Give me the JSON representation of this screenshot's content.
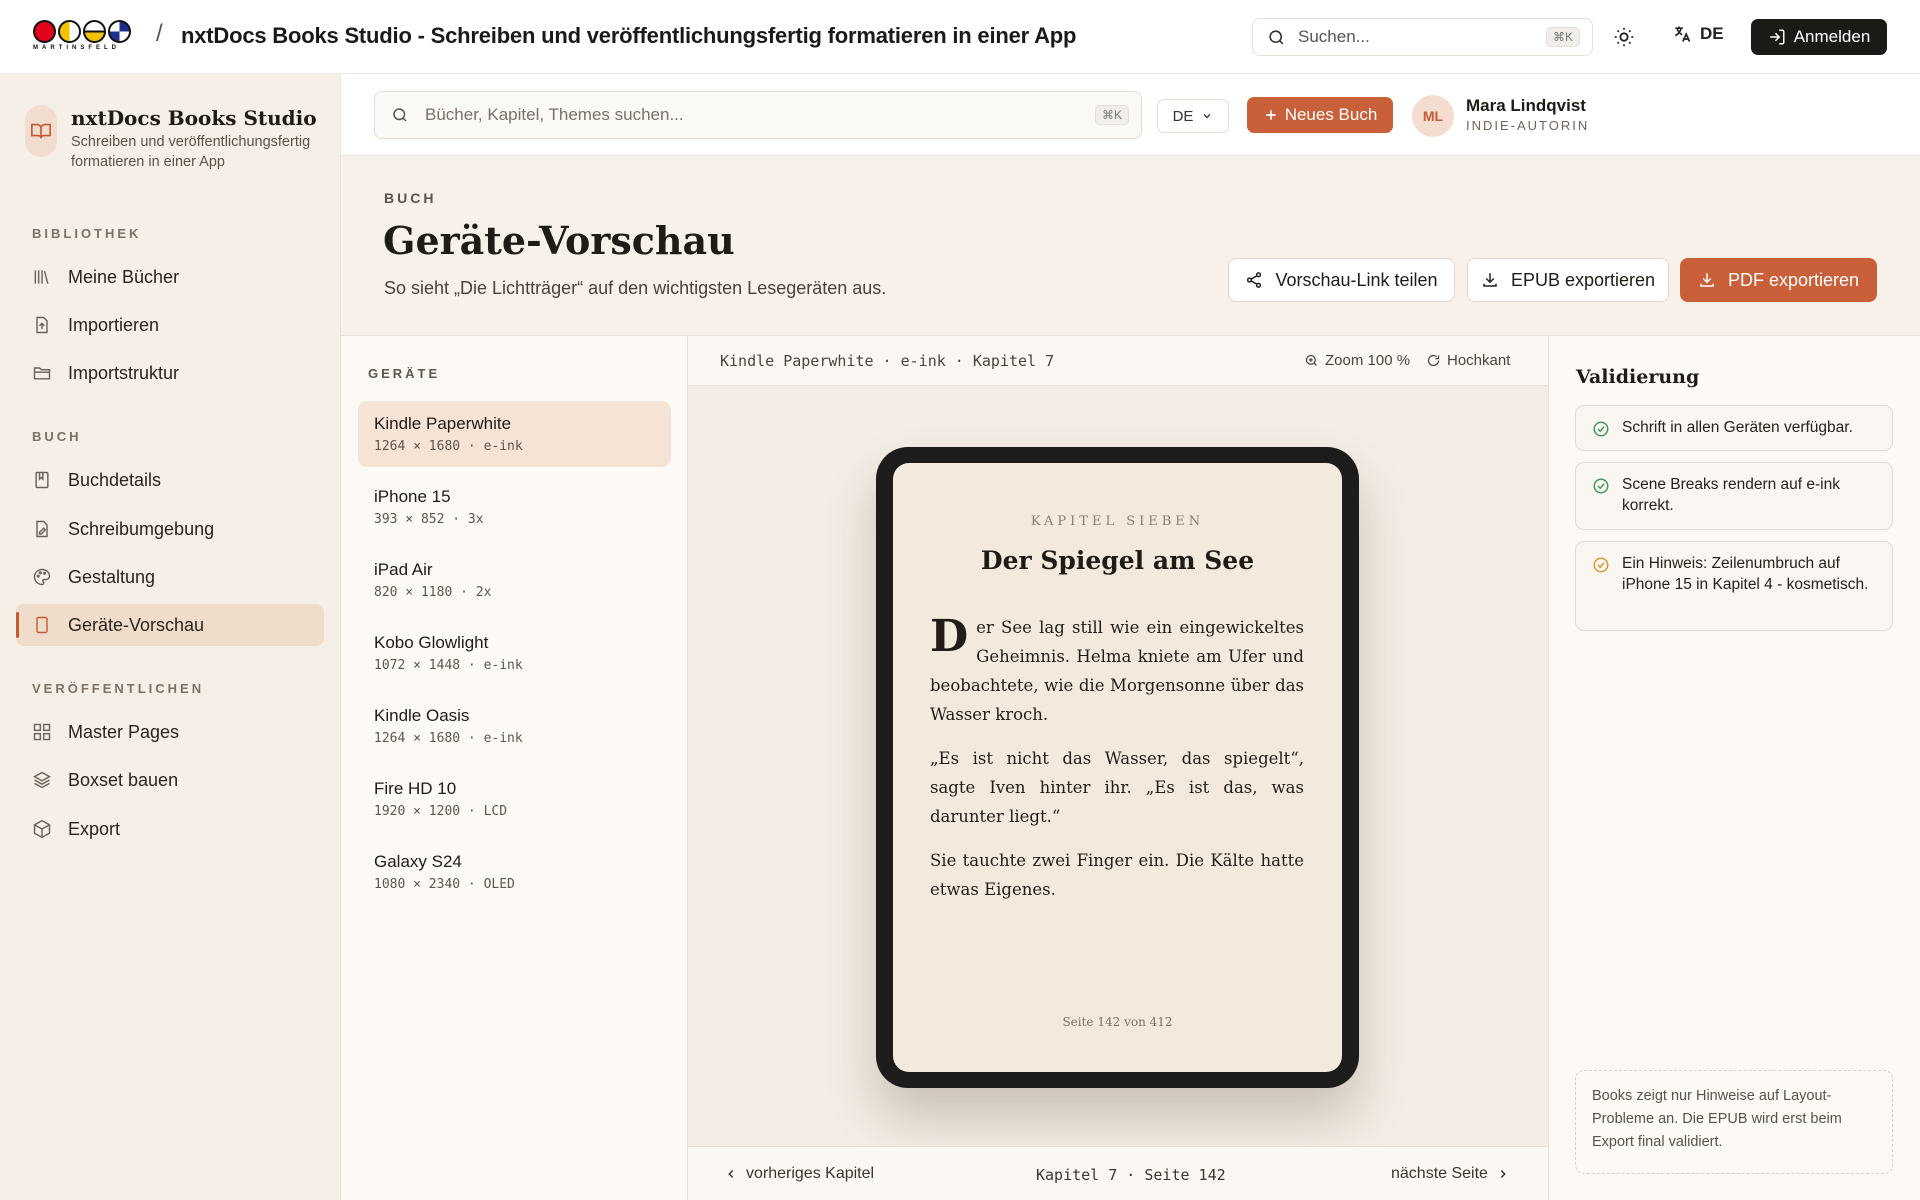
{
  "topbar": {
    "logo_text": "MARTINSFELD",
    "separator": "/",
    "title": "nxtDocs Books Studio - Schreiben und veröffentlichungsfertig formatieren in einer App",
    "search_placeholder": "Suchen...",
    "search_shortcut": "⌘K",
    "language": "DE",
    "login_label": "Anmelden"
  },
  "sidebar": {
    "brand_name": "nxtDocs Books Studio",
    "brand_sub": "Schreiben und veröffentlichungsfertig formatieren in einer App",
    "sections": [
      {
        "label": "BIBLIOTHEK",
        "items": [
          {
            "label": "Meine Bücher",
            "icon": "library-icon"
          },
          {
            "label": "Importieren",
            "icon": "import-icon"
          },
          {
            "label": "Importstruktur",
            "icon": "folder-icon"
          }
        ]
      },
      {
        "label": "BUCH",
        "items": [
          {
            "label": "Buchdetails",
            "icon": "book-icon"
          },
          {
            "label": "Schreibumgebung",
            "icon": "edit-document-icon"
          },
          {
            "label": "Gestaltung",
            "icon": "palette-icon"
          },
          {
            "label": "Geräte-Vorschau",
            "icon": "tablet-icon",
            "active": true
          }
        ]
      },
      {
        "label": "VERÖFFENTLICHEN",
        "items": [
          {
            "label": "Master Pages",
            "icon": "grid-icon"
          },
          {
            "label": "Boxset bauen",
            "icon": "layers-icon"
          },
          {
            "label": "Export",
            "icon": "package-icon"
          }
        ]
      }
    ]
  },
  "header": {
    "search_placeholder": "Bücher, Kapitel, Themes suchen...",
    "search_shortcut": "⌘K",
    "language_select": "DE",
    "new_book_label": "Neues Buch",
    "user_initials": "ML",
    "user_name": "Mara Lindqvist",
    "user_role": "INDIE-AUTORIN"
  },
  "page": {
    "eyebrow": "BUCH",
    "title": "Geräte-Vorschau",
    "subtitle": "So sieht „Die Lichtträger“ auf den wichtigsten Lesegeräten aus.",
    "share_label": "Vorschau-Link teilen",
    "epub_label": "EPUB exportieren",
    "pdf_label": "PDF exportieren"
  },
  "devices": {
    "label": "GERÄTE",
    "items": [
      {
        "name": "Kindle Paperwhite",
        "spec": "1264 × 1680 · e-ink",
        "active": true
      },
      {
        "name": "iPhone 15",
        "spec": "393 × 852 · 3x"
      },
      {
        "name": "iPad Air",
        "spec": "820 × 1180 · 2x"
      },
      {
        "name": "Kobo Glowlight",
        "spec": "1072 × 1448 · e-ink"
      },
      {
        "name": "Kindle Oasis",
        "spec": "1264 × 1680 · e-ink"
      },
      {
        "name": "Fire HD 10",
        "spec": "1920 × 1200 · LCD"
      },
      {
        "name": "Galaxy S24",
        "spec": "1080 × 2340 · OLED"
      }
    ]
  },
  "preview": {
    "info": "Kindle Paperwhite · e-ink · Kapitel 7",
    "zoom": "Zoom 100 %",
    "orientation": "Hochkant",
    "chapter_label": "KAPITEL SIEBEN",
    "chapter_title": "Der Spiegel am See",
    "dropcap": "D",
    "para1": "er See lag still wie ein eingewickeltes Geheimnis. Helma kniete am Ufer und beobachtete, wie die Morgensonne über das Wasser kroch.",
    "para2": "„Es ist nicht das Wasser, das spiegelt“, sagte Iven hinter ihr. „Es ist das, was darunter liegt.“",
    "para3": "Sie tauchte zwei Finger ein. Die Kälte hatte et­was Eigenes.",
    "page_number": "Seite 142 von 412",
    "prev_label": "vorheriges Kapitel",
    "position": "Kapitel 7 · Seite 142",
    "next_label": "nächste Seite"
  },
  "validation": {
    "title": "Validierung",
    "items": [
      {
        "text": "Schrift in allen Geräten verfügbar.",
        "status": "ok",
        "color": "#3f9a5b"
      },
      {
        "text": "Scene Breaks rendern auf e-ink korrekt.",
        "status": "ok",
        "color": "#3f9a5b"
      },
      {
        "text": "Ein Hinweis: Zeilenumbruch auf iPhone 15 in Kapitel 4 - kosmetisch.",
        "status": "warning",
        "color": "#d99a2b"
      }
    ],
    "note": "Books zeigt nur Hinweise auf Layout-Probleme an. Die EPUB wird erst beim Export final validiert."
  },
  "colors": {
    "accent": "#c9603a",
    "sidebar_active": "#f0dccb",
    "dark_button": "#1c1a17"
  }
}
